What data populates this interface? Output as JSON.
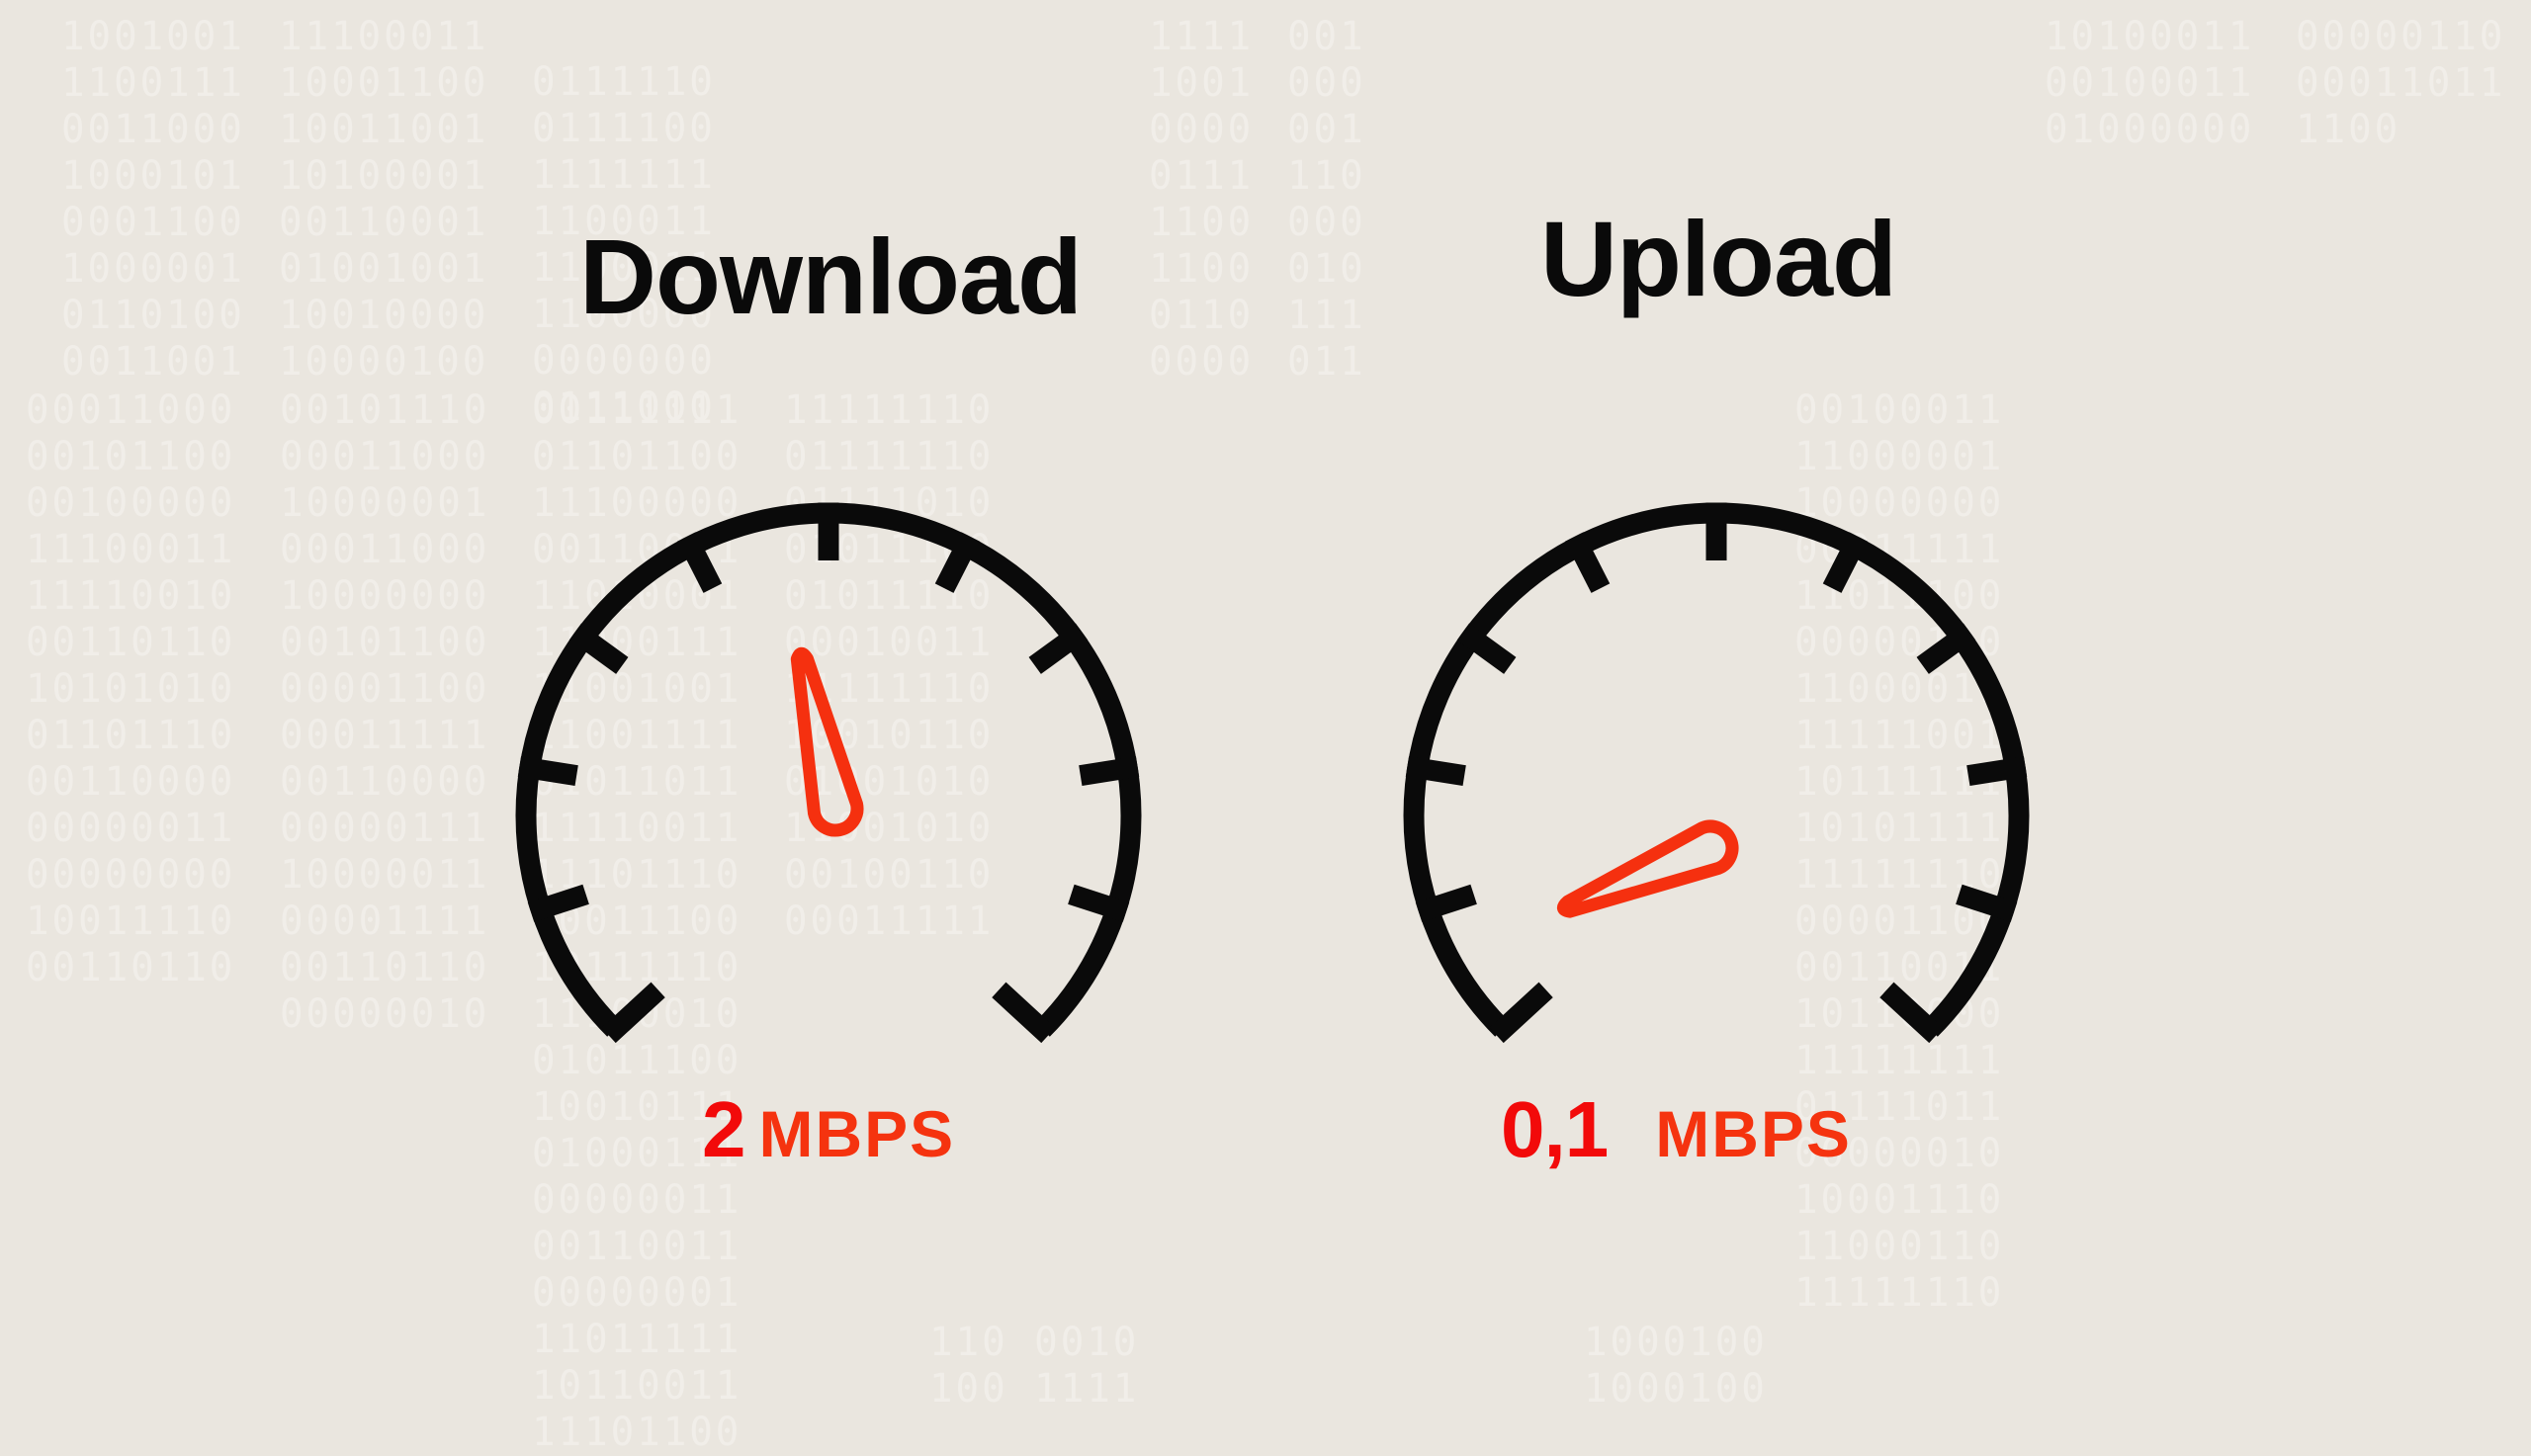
{
  "colors": {
    "background": "#EAE6DF",
    "binary_text": "#F1EEE9",
    "gauge_stroke": "#0A0A0A",
    "needle": "#F5300F",
    "value_number": "#F20A0A",
    "value_unit": "#F5330F",
    "title": "#0A0A0A"
  },
  "gauges": [
    {
      "id": "download",
      "title": "Download",
      "value": "2",
      "unit": "MBPS",
      "needle_fraction": 0.455,
      "tick_count": 11
    },
    {
      "id": "upload",
      "title": "Upload",
      "value": "0,1",
      "unit": "MBPS",
      "needle_fraction": 0.085,
      "tick_count": 11
    }
  ],
  "background_binary": [
    {
      "col": "a",
      "rows": [
        "1001001",
        "1100111",
        "0011000",
        "1000101",
        "0001100",
        "1000001",
        "0110100",
        "0011001"
      ]
    },
    {
      "col": "b",
      "rows": [
        "11100011",
        "10001100",
        "10011001",
        "10100001",
        "00110001",
        "01001001",
        "10010000",
        "10000100"
      ]
    },
    {
      "col": "c",
      "rows": [
        "0111110",
        "0111100",
        "1111111",
        "1100011",
        "1100011",
        "1100000",
        "0000000",
        "0111000"
      ]
    },
    {
      "col": "d",
      "rows": [
        "1111",
        "1001",
        "0000",
        "0111",
        "1100",
        "1100",
        "0110",
        "0000"
      ]
    },
    {
      "col": "e",
      "rows": [
        "001",
        "000",
        "001",
        "110",
        "000",
        "010",
        "111",
        "011"
      ]
    },
    {
      "col": "f",
      "rows": [
        "10100011",
        "00100011",
        "01000000"
      ]
    },
    {
      "col": "g",
      "rows": [
        "00000110",
        "00011011",
        "1100"
      ]
    },
    {
      "col": "h",
      "rows": [
        "00011000",
        "00101100",
        "00100000",
        "11100011",
        "11110010",
        "00110110",
        "10101010",
        "01101110",
        "00110000",
        "00000011",
        "00000000",
        "10011110",
        "00110110"
      ]
    },
    {
      "col": "i",
      "rows": [
        "00101110",
        "00011000",
        "10000001",
        "00011000",
        "10000000",
        "00101100",
        "00001100",
        "00011111",
        "00110000",
        "00000111",
        "10000011",
        "00001111",
        "00110110",
        "00000010"
      ]
    },
    {
      "col": "j",
      "rows": [
        "00111111",
        "01101100",
        "11100000",
        "00110011",
        "11010001",
        "11000111",
        "11001001",
        "11001111",
        "01011011",
        "11110011",
        "11101110",
        "00011100",
        "10111110",
        "11100010",
        "01011100",
        "10010111",
        "01000111",
        "00000011",
        "00110011",
        "00000001",
        "11011111",
        "10110011",
        "11101100"
      ]
    },
    {
      "col": "k",
      "rows": [
        "11111110",
        "01111110",
        "01111010",
        "01011100",
        "01011110",
        "00010011",
        "11111110",
        "10010110",
        "01001010",
        "11001010",
        "00100110",
        "00011111"
      ]
    },
    {
      "col": "l",
      "rows": [
        "00100011",
        "11000001",
        "10000000",
        "00011111",
        "11011100",
        "00000110",
        "11000011",
        "11111001",
        "10111111",
        "10101111",
        "11111110",
        "00001100",
        "00110011",
        "10110000",
        "11111111",
        "01111011",
        "00000010",
        "10001110",
        "11000110",
        "11111110"
      ]
    },
    {
      "col": "m",
      "rows": [
        "110 0010",
        "100 1111"
      ]
    },
    {
      "col": "n",
      "rows": [
        "1000100",
        "1000100"
      ]
    }
  ]
}
